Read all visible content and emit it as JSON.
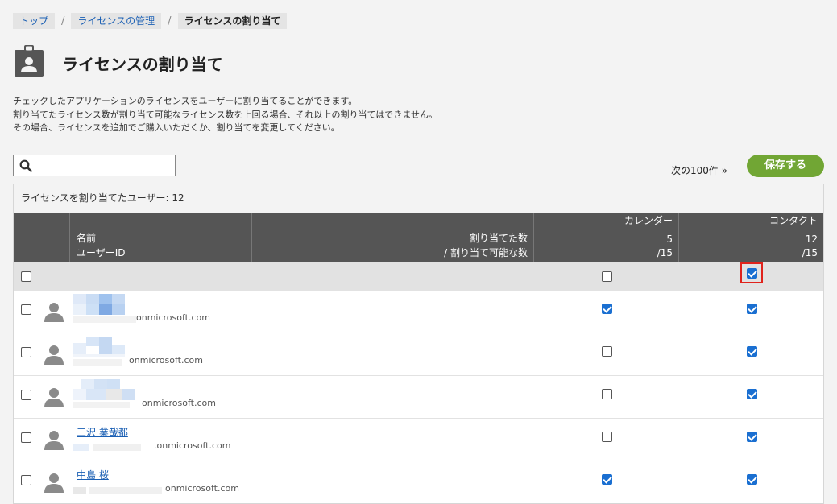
{
  "breadcrumb": {
    "top": "トップ",
    "license_mgmt": "ライセンスの管理",
    "current": "ライセンスの割り当て",
    "sep": "/"
  },
  "title": "ライセンスの割り当て",
  "description": [
    "チェックしたアプリケーションのライセンスをユーザーに割り当てることができます。",
    "割り当てたライセンス数が割り当て可能なライセンス数を上回る場合、それ以上の割り当てはできません。",
    "その場合、ライセンスを追加でご購入いただくか、割り当てを変更してください。"
  ],
  "search": {
    "placeholder": ""
  },
  "next_link": "次の100件 »",
  "save_label": "保存する",
  "assigned_users": "ライセンスを割り当てたユーザー: 12",
  "table": {
    "col_name": "名前",
    "col_userid": "ユーザーID",
    "col_assigned": "割り当てた数",
    "col_assignable": "/ 割り当て可能な数",
    "apps": [
      {
        "name": "カレンダー",
        "assigned": "5",
        "total": "/15"
      },
      {
        "name": "コンタクト",
        "assigned": "12",
        "total": "/15"
      }
    ]
  },
  "select_all": {
    "row": false,
    "calendar": false,
    "contact": true
  },
  "users": [
    {
      "name": "",
      "email_suffix": "onmicrosoft.com",
      "checked": false,
      "calendar": true,
      "contact": true
    },
    {
      "name": "",
      "email_suffix": "onmicrosoft.com",
      "checked": false,
      "calendar": false,
      "contact": true
    },
    {
      "name": "",
      "email_suffix": "onmicrosoft.com",
      "checked": false,
      "calendar": false,
      "contact": true
    },
    {
      "name": "三沢 業哉都",
      "email_suffix": ".onmicrosoft.com",
      "checked": false,
      "calendar": false,
      "contact": true
    },
    {
      "name": "中島 桜",
      "email_suffix": "onmicrosoft.com",
      "checked": false,
      "calendar": true,
      "contact": true
    }
  ],
  "colors": {
    "accent": "#71a634",
    "link": "#1a5fb4",
    "checkbox": "#1a6fd1",
    "header": "#555555",
    "highlight": "#e0231c"
  }
}
